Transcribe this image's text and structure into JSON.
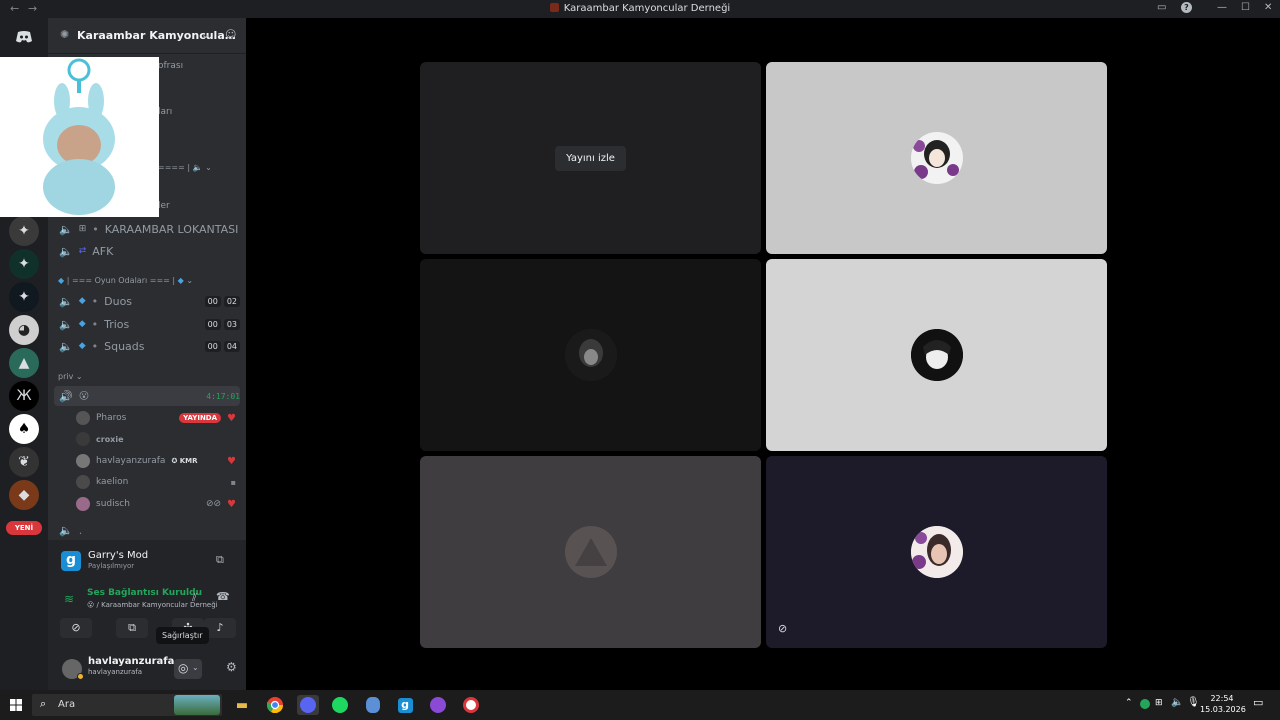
{
  "window": {
    "title": "Karaambar Kamyoncular Derneği"
  },
  "server": {
    "name": "Karaambar Kamyoncula…",
    "fragments": [
      "ofrası",
      "ları",
      "ler"
    ]
  },
  "channels": [
    {
      "name": "KARAAMBAR LOKANTASI",
      "icon": "⊞"
    },
    {
      "name": "AFK",
      "icon": "⇄"
    }
  ],
  "game_category": {
    "label": "| === Oyun Odaları === |"
  },
  "game_channels": [
    {
      "name": "Duos",
      "counts": [
        "00",
        "02"
      ]
    },
    {
      "name": "Trios",
      "counts": [
        "00",
        "03"
      ]
    },
    {
      "name": "Squads",
      "counts": [
        "00",
        "04"
      ]
    }
  ],
  "priv_category": {
    "label": "priv"
  },
  "active_voice": {
    "timer": "4:17:01"
  },
  "voice_users": [
    {
      "name": "Pharos",
      "badge": "YAYINDA"
    },
    {
      "name": "croxie"
    },
    {
      "name": "havlayanzurafa",
      "tag": "KMR"
    },
    {
      "name": "kaelion"
    },
    {
      "name": "sudisch"
    }
  ],
  "new_badge": "YENİ",
  "activity": {
    "title": "Garry's Mod",
    "subtitle": "Paylaşılmıyor"
  },
  "voice_status": {
    "title": "Ses Bağlantısı Kuruldu",
    "subtitle": "/ Karaambar Kamyoncular Derneği"
  },
  "tooltip": "Sağırlaştır",
  "me": {
    "display": "havlayanzurafa",
    "username": "havlayanzurafa"
  },
  "stage": {
    "watch_label": "Yayını izle"
  },
  "taskbar": {
    "search_placeholder": "Ara",
    "time": "22:54",
    "date": "15.03.2026"
  },
  "colors": {
    "accent": "#5865f2",
    "green": "#23a55a",
    "red": "#da373c"
  }
}
